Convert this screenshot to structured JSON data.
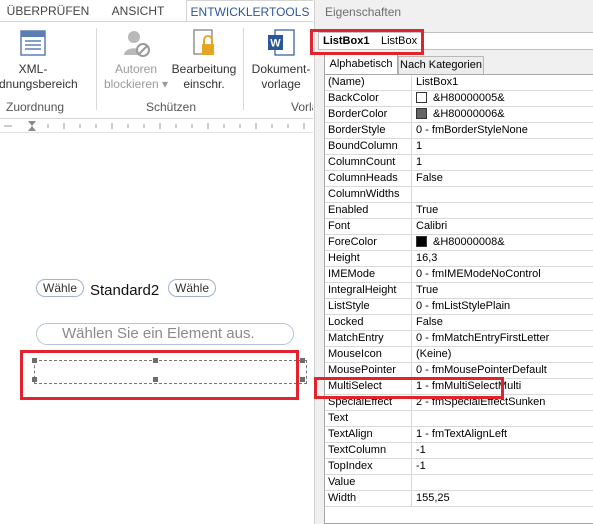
{
  "ribbon": {
    "tabs": [
      "ÜBERPRÜFEN",
      "ANSICHT",
      "ENTWICKLERTOOLS"
    ],
    "buttons": {
      "xml": {
        "line1": "XML-",
        "line2": "ordnungsbereich"
      },
      "autoren": {
        "line1": "Autoren",
        "line2": "blockieren ▾"
      },
      "bearbeitung": {
        "line1": "Bearbeitung",
        "line2": "einschr."
      },
      "dokument": {
        "line1": "Dokument-",
        "line2": "vorlage"
      }
    },
    "groups": [
      "Zuordnung",
      "Schützen",
      "Vorla"
    ]
  },
  "document": {
    "tag_label": "Wähle",
    "field_value": "Standard2",
    "placeholder": "Wählen Sie ein Element aus."
  },
  "panel": {
    "title": "Eigenschaften",
    "object_name": "ListBox1",
    "object_type": "ListBox",
    "tabs": [
      "Alphabetisch",
      "Nach Kategorien"
    ],
    "properties": [
      {
        "name": "(Name)",
        "value": "ListBox1"
      },
      {
        "name": "BackColor",
        "value": "&H80000005&",
        "swatch": "#ffffff"
      },
      {
        "name": "BorderColor",
        "value": "&H80000006&",
        "swatch": "#646464"
      },
      {
        "name": "BorderStyle",
        "value": "0 - fmBorderStyleNone"
      },
      {
        "name": "BoundColumn",
        "value": "1"
      },
      {
        "name": "ColumnCount",
        "value": "1"
      },
      {
        "name": "ColumnHeads",
        "value": "False"
      },
      {
        "name": "ColumnWidths",
        "value": ""
      },
      {
        "name": "Enabled",
        "value": "True"
      },
      {
        "name": "Font",
        "value": "Calibri"
      },
      {
        "name": "ForeColor",
        "value": "&H80000008&",
        "swatch": "#000000"
      },
      {
        "name": "Height",
        "value": "16,3"
      },
      {
        "name": "IMEMode",
        "value": "0 - fmIMEModeNoControl"
      },
      {
        "name": "IntegralHeight",
        "value": "True"
      },
      {
        "name": "ListStyle",
        "value": "0 - fmListStylePlain"
      },
      {
        "name": "Locked",
        "value": "False"
      },
      {
        "name": "MatchEntry",
        "value": "0 - fmMatchEntryFirstLetter"
      },
      {
        "name": "MouseIcon",
        "value": "(Keine)"
      },
      {
        "name": "MousePointer",
        "value": "0 - fmMousePointerDefault"
      },
      {
        "name": "MultiSelect",
        "value": "1 - fmMultiSelectMulti"
      },
      {
        "name": "SpecialEffect",
        "value": "2 - fmSpecialEffectSunken"
      },
      {
        "name": "Text",
        "value": ""
      },
      {
        "name": "TextAlign",
        "value": "1 - fmTextAlignLeft"
      },
      {
        "name": "TextColumn",
        "value": "-1"
      },
      {
        "name": "TopIndex",
        "value": "-1"
      },
      {
        "name": "Value",
        "value": ""
      },
      {
        "name": "Width",
        "value": "155,25"
      }
    ]
  },
  "colors": {
    "highlight": "#e1232e",
    "accent": "#2b579a"
  }
}
